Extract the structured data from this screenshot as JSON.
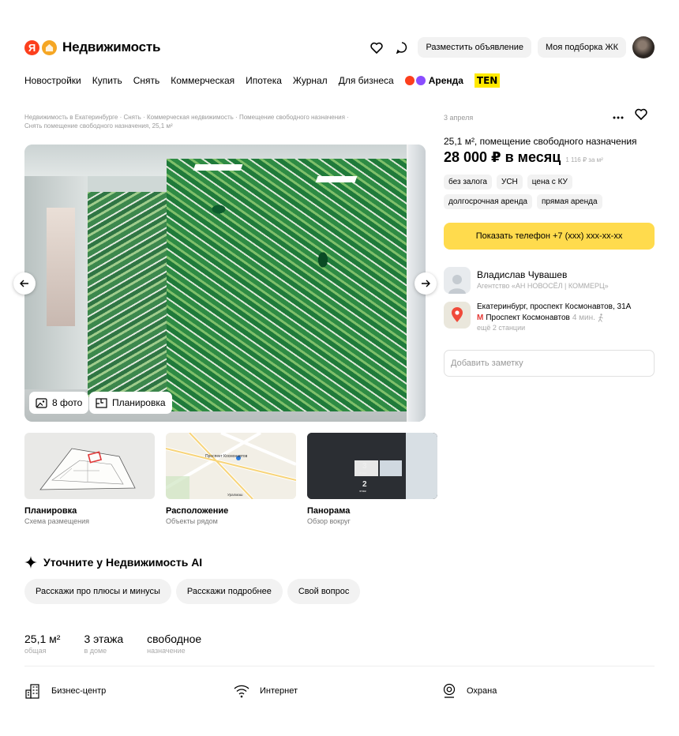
{
  "header": {
    "logo_text": "Недвижимость",
    "logo_letter": "Я",
    "post_ad_button": "Разместить объявление",
    "my_selection_button": "Моя подборка ЖК"
  },
  "nav": {
    "items": [
      "Новостройки",
      "Купить",
      "Снять",
      "Коммерческая",
      "Ипотека",
      "Журнал",
      "Для бизнеса"
    ],
    "arenda": "Аренда",
    "ten": "TEN"
  },
  "breadcrumb": {
    "items": [
      "Недвижимость в Екатеринбурге",
      "Снять",
      "Коммерческая недвижимость",
      "Помещение свободного назначения",
      "Снять помещение свободного назначения, 25,1 м²"
    ],
    "separator": "·"
  },
  "gallery": {
    "photos_label": "8 фото",
    "plan_label": "Планировка"
  },
  "thumbs": [
    {
      "title": "Планировка",
      "sub": "Схема размещения"
    },
    {
      "title": "Расположение",
      "sub": "Объекты рядом"
    },
    {
      "title": "Панорама",
      "sub": "Обзор вокруг"
    }
  ],
  "ai": {
    "title": "Уточните у Недвижимость AI",
    "chips": [
      "Расскажи про плюсы и минусы",
      "Расскажи подробнее",
      "Свой вопрос"
    ]
  },
  "stats": [
    {
      "value": "25,1 м²",
      "label": "общая"
    },
    {
      "value": "3 этажа",
      "label": "в доме"
    },
    {
      "value": "свободное",
      "label": "назначение"
    }
  ],
  "features": [
    "Бизнес-центр",
    "Интернет",
    "Охрана"
  ],
  "listing": {
    "date": "3 апреля",
    "title": "25,1 м², помещение свободного назначения",
    "price": "28 000 ₽ в месяц",
    "price_per_m2": "1 116 ₽ за м²",
    "tags": [
      "без залога",
      "УСН",
      "цена с КУ",
      "долгосрочная аренда",
      "прямая аренда"
    ],
    "phone_button": "Показать телефон +7 (ххх) ххх-хх-хх"
  },
  "agent": {
    "name": "Владислав Чувашев",
    "org": "Агентство «АН НОВОСЁЛ | КОММЕРЦ»"
  },
  "address": {
    "main": "Екатеринбург, проспект Космонавтов, 31А",
    "metro": "Проспект Космонавтов",
    "metro_time": "4 мин.",
    "more": "ещё 2 станции"
  },
  "note": {
    "placeholder": "Добавить заметку"
  },
  "map_labels": {
    "station": "Проспект Космонавтов",
    "bottom": "Уралмаш"
  },
  "pano_labels": {
    "floor3_num": "3",
    "floor3_word": "этаж",
    "floor2_num": "2",
    "floor2_word": "этаж"
  },
  "colors": {
    "accent_yellow": "#ffdb4d",
    "brand_red": "#fc3f1d"
  }
}
